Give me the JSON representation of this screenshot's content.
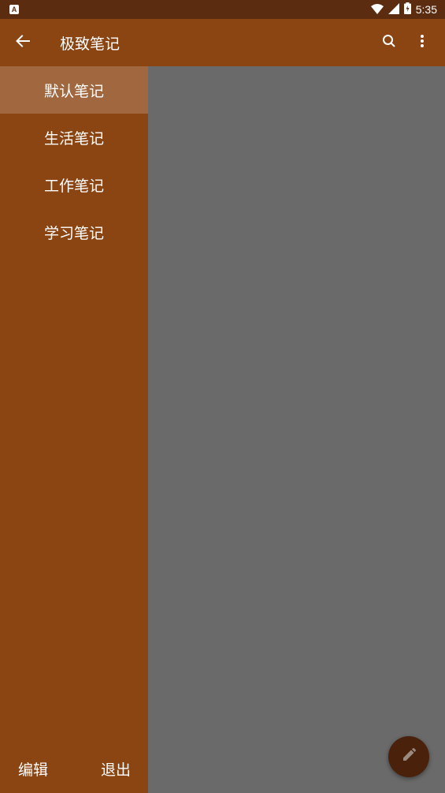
{
  "status_bar": {
    "notification_icon": "A",
    "time": "5:35",
    "icons": [
      "wifi-icon",
      "signal-icon",
      "battery-icon"
    ]
  },
  "app_bar": {
    "title": "极致笔记",
    "back_icon": "back-arrow-icon",
    "search_icon": "search-icon",
    "more_icon": "more-vert-icon"
  },
  "drawer": {
    "items": [
      {
        "label": "默认笔记",
        "selected": true
      },
      {
        "label": "生活笔记",
        "selected": false
      },
      {
        "label": "工作笔记",
        "selected": false
      },
      {
        "label": "学习笔记",
        "selected": false
      }
    ],
    "footer": {
      "edit_label": "编辑",
      "exit_label": "退出"
    }
  },
  "fab": {
    "icon": "pencil-icon"
  },
  "colors": {
    "primary": "#8b4513",
    "primary_dark": "#5c2c10",
    "selected_item": "#a1673f",
    "scrim": "#6a6a6a",
    "fab": "#4a220c"
  }
}
